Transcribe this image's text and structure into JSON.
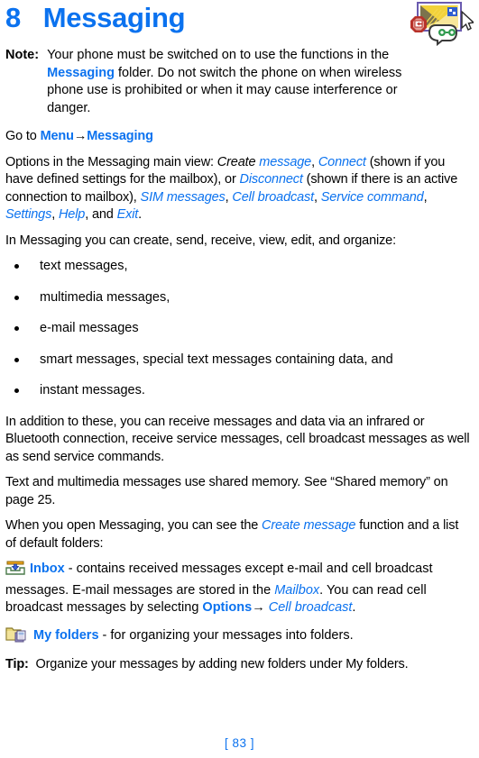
{
  "colors": {
    "accent_blue": "#0b72ef",
    "text_black": "#000000",
    "icon_yellow": "#f2d23a",
    "icon_orange": "#f08a12",
    "icon_red": "#b8322a",
    "icon_green": "#2f9b4e",
    "icon_purple": "#8a7fc0"
  },
  "header": {
    "chapter_number": "8",
    "chapter_title": "Messaging",
    "icon_name": "messaging-chapter-icon"
  },
  "note": {
    "label": "Note:",
    "text_part1": "Your phone must be switched on to use the functions in the ",
    "highlight": "Messaging",
    "text_part2": " folder.  Do not switch the phone on when wireless phone use is prohibited or when it may cause interference or danger."
  },
  "goto": {
    "prefix": "Go to ",
    "menu": "Menu",
    "arrow": "→",
    "target": "Messaging"
  },
  "options_paragraph": {
    "lead": "Options in the Messaging main view: ",
    "create_black": "Create",
    "message_blue": " message",
    "after_create": ", ",
    "connect": "Connect",
    "connect_note": " (shown if you have defined settings for the mailbox), or ",
    "disconnect": "Disconnect",
    "disconnect_note": " (shown if there is an active connection to mailbox), ",
    "sim_messages": "SIM messages",
    "sep1": ", ",
    "cell_broadcast": "Cell broadcast",
    "sep2": ", ",
    "service_command": "Service command",
    "sep3": ", ",
    "settings": "Settings",
    "sep4": ", ",
    "help": "Help",
    "and": ", and ",
    "exit": "Exit",
    "period": "."
  },
  "intro_list": {
    "lead": "In Messaging you can create, send, receive, view, edit, and organize:",
    "items": [
      "text messages,",
      "multimedia messages,",
      "e-mail messages",
      "smart messages, special text messages containing data, and",
      "instant messages."
    ]
  },
  "paragraphs": {
    "in_addition": "In addition to these, you can receive messages and data via an infrared or Bluetooth connection, receive service messages, cell broadcast messages as well as send service commands.",
    "shared_memory": "Text and multimedia messages use shared memory.  See “Shared memory” on page 25.",
    "when_open_pre": "When you open Messaging, you can see the ",
    "when_open_italic": "Create message",
    "when_open_post": " function and a list of default folders:"
  },
  "inbox": {
    "icon_name": "inbox-tray-icon",
    "label": "Inbox",
    "dash": " - ",
    "text_pre": "contains received messages except e-mail and cell broadcast messages. E-mail messages are stored in the ",
    "mailbox": "Mailbox",
    "text_mid": ". You can read cell broadcast messages by selecting ",
    "options": "Options",
    "arrow": "→",
    "cell_broadcast": " Cell broadcast",
    "period": "."
  },
  "my_folders": {
    "icon_name": "my-folders-icon",
    "label": "My folders",
    "text": " - for organizing your messages into folders."
  },
  "tip": {
    "label": "Tip:",
    "text": "Organize your messages by adding new folders under My folders."
  },
  "footer": {
    "page_number": "[ 83 ]"
  }
}
